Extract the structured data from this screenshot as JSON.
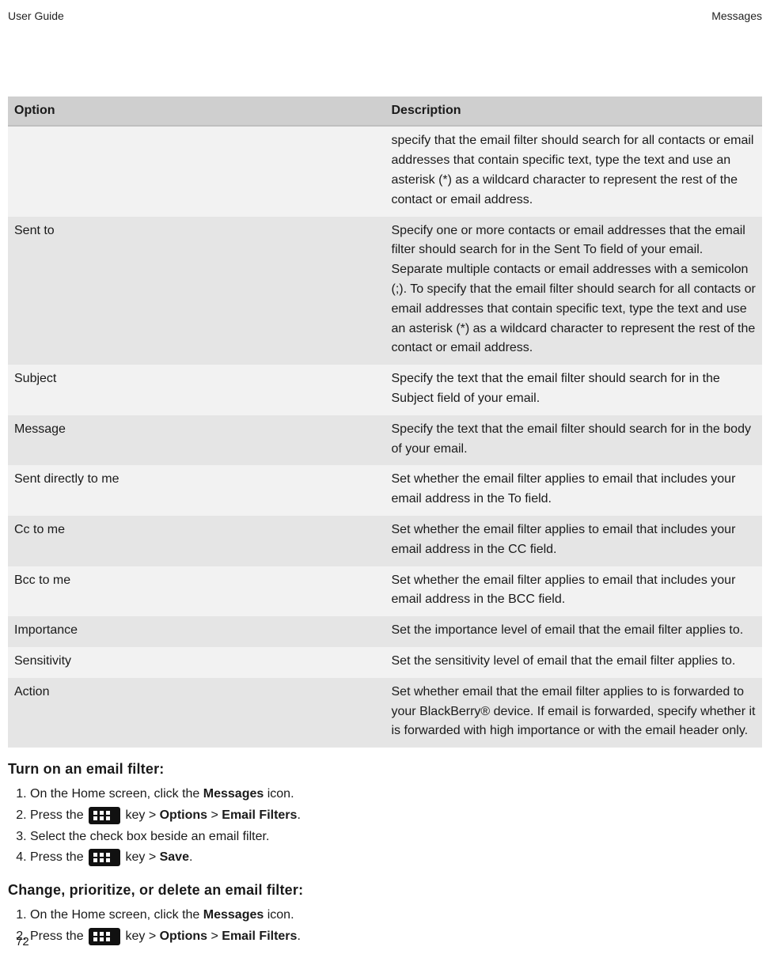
{
  "header": {
    "left": "User Guide",
    "right": "Messages"
  },
  "table": {
    "headers": {
      "option": "Option",
      "description": "Description"
    },
    "rows": [
      {
        "option": "",
        "description": "specify that the email filter should search for all contacts or email addresses that contain specific text, type the text and use an asterisk (*) as a wildcard character to represent the rest of the contact or email address.",
        "shade": "light"
      },
      {
        "option": "Sent to",
        "description": "Specify one or more contacts or email addresses that the email filter should search for in the Sent To field of your email. Separate multiple contacts or email addresses with a semicolon (;). To specify that the email filter should search for all contacts or email addresses that contain specific text, type the text and use an asterisk (*) as a wildcard character to represent the rest of the contact or email address.",
        "shade": "dark"
      },
      {
        "option": "Subject",
        "description": "Specify the text that the email filter should search for in the Subject field of your email.",
        "shade": "light"
      },
      {
        "option": "Message",
        "description": "Specify the text that the email filter should search for in the body of your email.",
        "shade": "dark"
      },
      {
        "option": "Sent directly to me",
        "description": "Set whether the email filter applies to email that includes your email address in the To field.",
        "shade": "light"
      },
      {
        "option": "Cc to me",
        "description": "Set whether the email filter applies to email that includes your email address in the CC field.",
        "shade": "dark"
      },
      {
        "option": "Bcc to me",
        "description": "Set whether the email filter applies to email that includes your email address in the BCC field.",
        "shade": "light"
      },
      {
        "option": "Importance",
        "description": "Set the importance level of email that the email filter applies to.",
        "shade": "dark"
      },
      {
        "option": "Sensitivity",
        "description": "Set the sensitivity level of email that the email filter applies to.",
        "shade": "light"
      },
      {
        "option": "Action",
        "description": "Set whether email that the email filter applies to is forwarded to your BlackBerry® device. If email is forwarded, specify whether it is forwarded with high importance or with the email header only.",
        "shade": "dark"
      }
    ]
  },
  "section1": {
    "title": "Turn on an email filter:",
    "step1_a": "On the Home screen, click the ",
    "step1_b": "Messages",
    "step1_c": " icon.",
    "step2_a": "Press the ",
    "step2_b": " key > ",
    "step2_c": "Options",
    "step2_d": " > ",
    "step2_e": "Email Filters",
    "step2_f": ".",
    "step3": "Select the check box beside an email filter.",
    "step4_a": "Press the ",
    "step4_b": " key > ",
    "step4_c": "Save",
    "step4_d": "."
  },
  "section2": {
    "title": "Change, prioritize, or delete an email filter:",
    "step1_a": "On the Home screen, click the ",
    "step1_b": "Messages",
    "step1_c": " icon.",
    "step2_a": "Press the ",
    "step2_b": " key > ",
    "step2_c": "Options",
    "step2_d": " > ",
    "step2_e": "Email Filters",
    "step2_f": "."
  },
  "page_number": "72"
}
